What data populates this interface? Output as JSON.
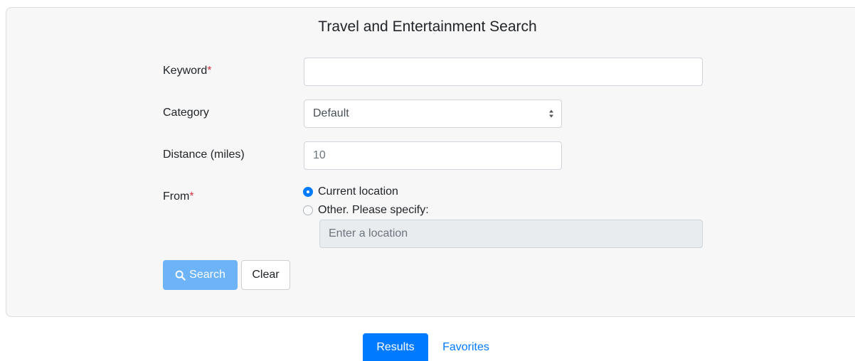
{
  "form": {
    "title": "Travel and Entertainment Search",
    "keyword": {
      "label": "Keyword",
      "required_mark": "*",
      "value": ""
    },
    "category": {
      "label": "Category",
      "selected": "Default"
    },
    "distance": {
      "label": "Distance (miles)",
      "placeholder": "10"
    },
    "from": {
      "label": "From",
      "required_mark": "*",
      "option_current": "Current location",
      "option_other": "Other. Please specify:",
      "selected": "Current location",
      "location_placeholder": "Enter a location"
    },
    "buttons": {
      "search_label": "Search",
      "search_icon": "search-icon",
      "clear_label": "Clear"
    }
  },
  "tabs": {
    "results_label": "Results",
    "favorites_label": "Favorites",
    "active": "Results"
  },
  "colors": {
    "primary": "#007bff",
    "search_button": "#6cb4f7",
    "required": "#dc3545",
    "panel_bg": "#f7f7f7"
  }
}
